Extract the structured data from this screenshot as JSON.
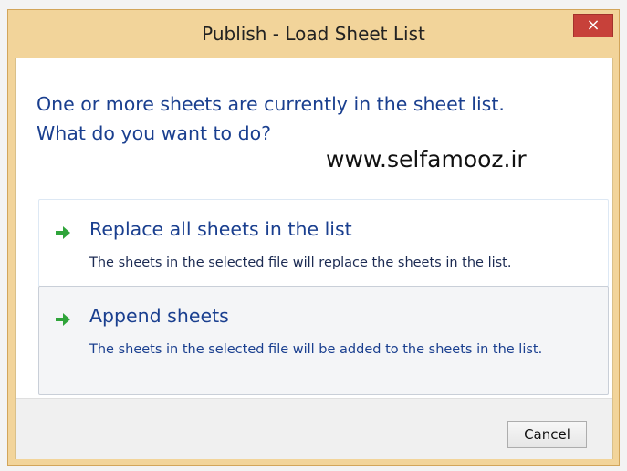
{
  "window": {
    "title": "Publish - Load Sheet List",
    "close_label": "×"
  },
  "instruction": {
    "line1": "One or more sheets are currently in the sheet list.",
    "line2": "What do you want to do?"
  },
  "watermark": "www.selfamooz.ir",
  "options": [
    {
      "title": "Replace all sheets in the list",
      "description": "The sheets in the selected file will replace the sheets in the list.",
      "icon": "green-arrow-icon"
    },
    {
      "title": "Append sheets",
      "description": "The sheets in the selected file will be added to the sheets in the list.",
      "icon": "green-arrow-icon"
    }
  ],
  "footer": {
    "cancel_label": "Cancel"
  },
  "colors": {
    "title_bar": "#f2d49a",
    "close_button": "#c7413a",
    "instruction_text": "#1a3f8f",
    "arrow": "#2fa43a"
  }
}
